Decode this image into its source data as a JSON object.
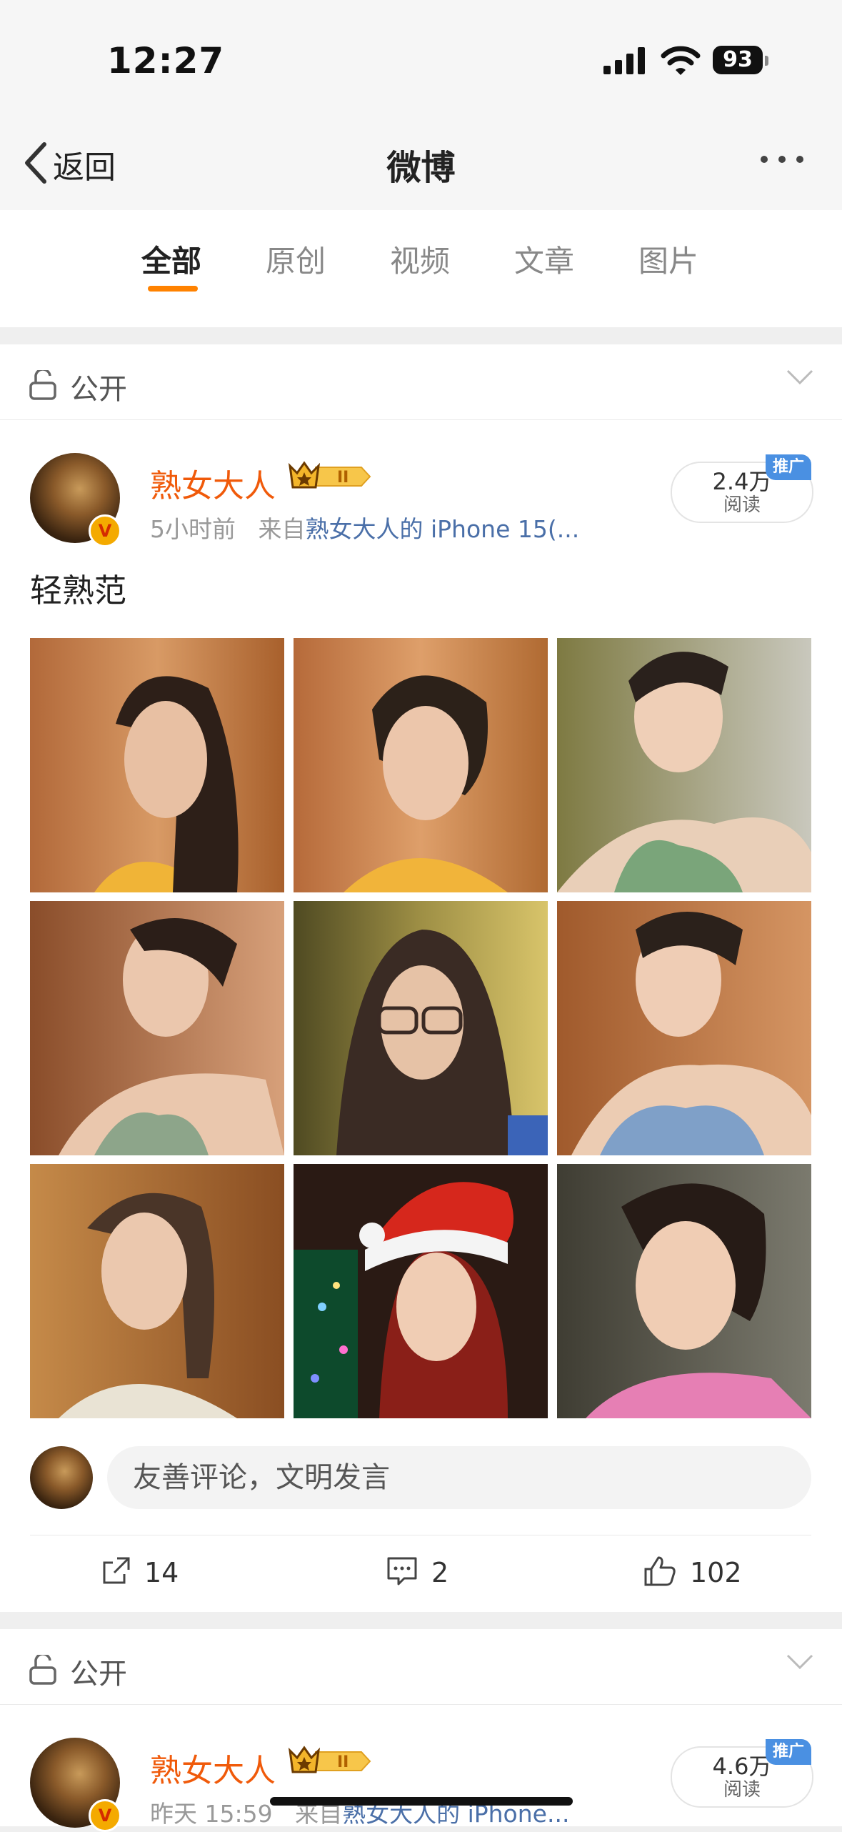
{
  "status_bar": {
    "time": "12:27",
    "battery": "93"
  },
  "nav": {
    "back_label": "返回",
    "title": "微博"
  },
  "tabs": [
    {
      "label": "全部",
      "active": true
    },
    {
      "label": "原创",
      "active": false
    },
    {
      "label": "视频",
      "active": false
    },
    {
      "label": "文章",
      "active": false
    },
    {
      "label": "图片",
      "active": false
    }
  ],
  "posts": [
    {
      "visibility": "公开",
      "user": "熟女大人",
      "vip_level": "II",
      "time": "5小时前",
      "source_prefix": "来自",
      "source": "熟女大人的 iPhone 15(...",
      "reads_count": "2.4万",
      "reads_label": "阅读",
      "promo_label": "推广",
      "text": "轻熟范",
      "photos": [
        "selfie-1",
        "selfie-2",
        "selfie-3",
        "selfie-4",
        "selfie-5",
        "selfie-6",
        "selfie-7",
        "selfie-8",
        "selfie-9"
      ],
      "comment_placeholder": "友善评论，文明发言",
      "actions": {
        "repost": "14",
        "comment": "2",
        "like": "102"
      }
    },
    {
      "visibility": "公开",
      "user": "熟女大人",
      "vip_level": "II",
      "time": "昨天 15:59",
      "source_prefix": "来自",
      "source": "熟女大人的 iPhone...",
      "reads_count": "4.6万",
      "reads_label": "阅读",
      "promo_label": "推广"
    }
  ],
  "colors": {
    "accent": "#ff8200",
    "username": "#f05a0a",
    "link": "#4a6fa8",
    "promo": "#4a90e2"
  }
}
